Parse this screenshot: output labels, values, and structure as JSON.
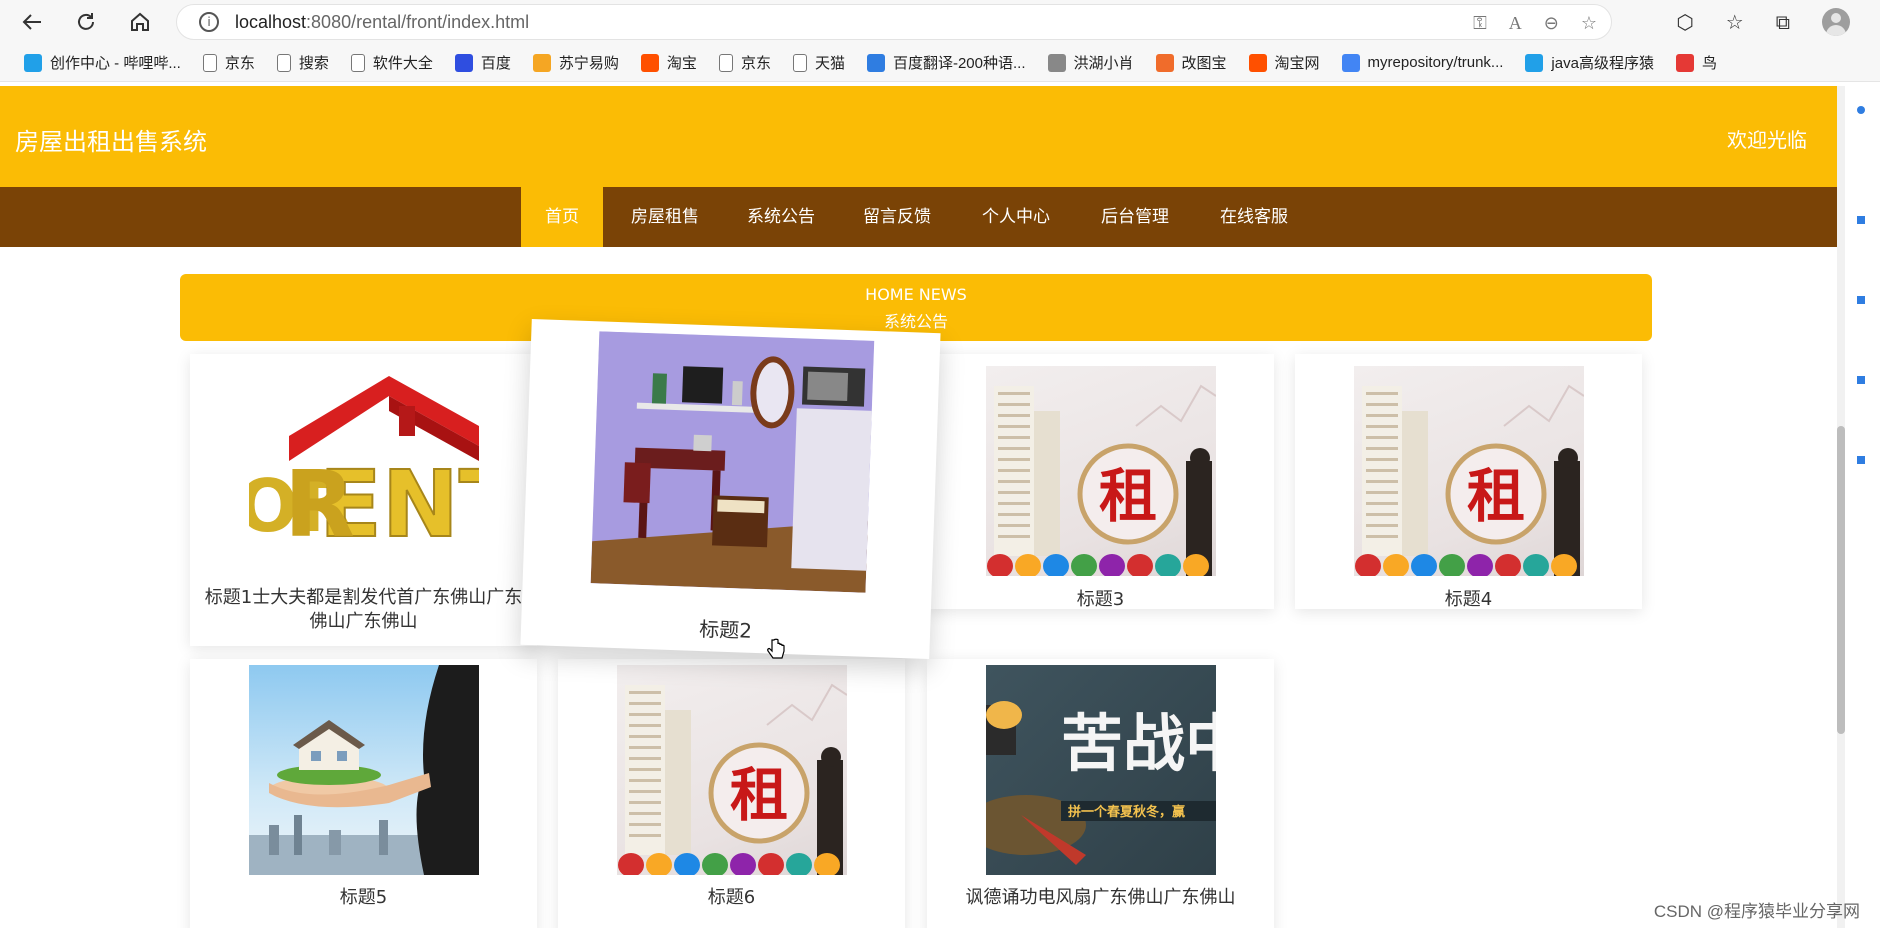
{
  "browser": {
    "url_host": "localhost",
    "url_rest": ":8080/rental/front/index.html",
    "bookmarks": [
      {
        "label": "创作中心 - 哔哩哔...",
        "icon": "bilibili-icon",
        "color": "#21a0e8"
      },
      {
        "label": "京东",
        "icon": "page-icon",
        "color": "#777777"
      },
      {
        "label": "搜索",
        "icon": "page-icon",
        "color": "#777777"
      },
      {
        "label": "软件大全",
        "icon": "page-icon",
        "color": "#777777"
      },
      {
        "label": "百度",
        "icon": "baidu-paw-icon",
        "color": "#2f4ee0"
      },
      {
        "label": "苏宁易购",
        "icon": "suning-icon",
        "color": "#f5a623"
      },
      {
        "label": "淘宝",
        "icon": "taobao-icon",
        "color": "#ff5000"
      },
      {
        "label": "京东",
        "icon": "page-icon",
        "color": "#777777"
      },
      {
        "label": "天猫",
        "icon": "page-icon",
        "color": "#777777"
      },
      {
        "label": "百度翻译-200种语...",
        "icon": "translate-icon",
        "color": "#2f7de1"
      },
      {
        "label": "洪湖小肖",
        "icon": "avatar-icon",
        "color": "#888888"
      },
      {
        "label": "改图宝",
        "icon": "gaitubao-icon",
        "color": "#f06c2b"
      },
      {
        "label": "淘宝网",
        "icon": "taobao-icon",
        "color": "#ff5000"
      },
      {
        "label": "myrepository/trunk...",
        "icon": "chrome-icon",
        "color": "#4285f4"
      },
      {
        "label": "java高级程序猿",
        "icon": "bilibili-icon",
        "color": "#21a0e8"
      },
      {
        "label": "鸟",
        "icon": "bird-icon",
        "color": "#e53935"
      }
    ]
  },
  "header": {
    "title": "房屋出租出售系统",
    "welcome": "欢迎光临"
  },
  "nav": {
    "items": [
      {
        "label": "首页",
        "active": true
      },
      {
        "label": "房屋租售",
        "active": false
      },
      {
        "label": "系统公告",
        "active": false
      },
      {
        "label": "留言反馈",
        "active": false
      },
      {
        "label": "个人中心",
        "active": false
      },
      {
        "label": "后台管理",
        "active": false
      },
      {
        "label": "在线客服",
        "active": false
      }
    ]
  },
  "news": {
    "title_en": "HOME NEWS",
    "title_cn": "系统公告"
  },
  "cards": [
    {
      "title": "标题1士大夫都是割发代首广东佛山广东佛山广东佛山",
      "image": "rent-house-image"
    },
    {
      "title": "标题2",
      "image": "room-interior-image"
    },
    {
      "title": "标题3",
      "image": "zu-magnifier-image"
    },
    {
      "title": "标题4",
      "image": "zu-magnifier-image"
    },
    {
      "title": "标题5",
      "image": "house-in-hand-image"
    },
    {
      "title": "标题6",
      "image": "zu-magnifier-image"
    },
    {
      "title": "讽德诵功电风扇广东佛山广东佛山",
      "image": "kuzhan-poster-image"
    }
  ],
  "kuzhan_text": "苦战",
  "kuzhan_sub": "拼一个春夏秋冬，赢",
  "zu_char": "租",
  "watermark": "CSDN @程序猿毕业分享网",
  "colors": {
    "header_yellow": "#fbbc05",
    "nav_brown": "#7a4306"
  }
}
